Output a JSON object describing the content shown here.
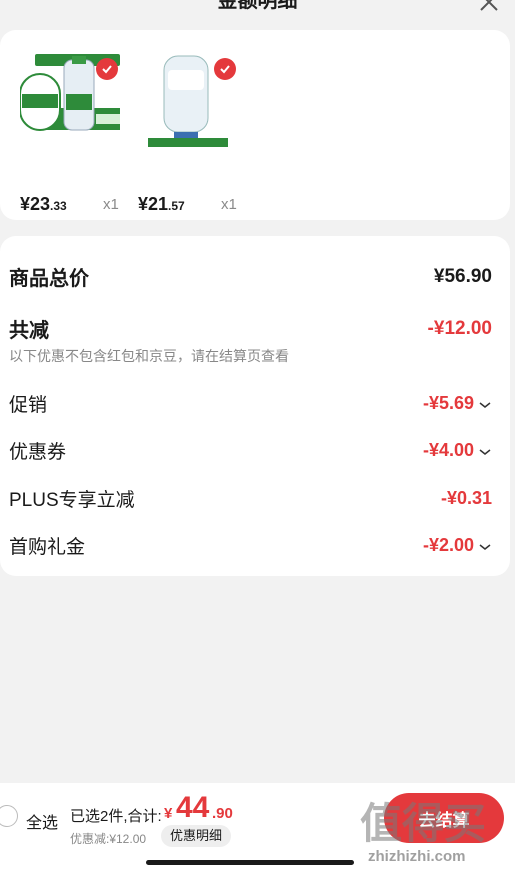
{
  "header": {
    "title": "金额明细"
  },
  "products": [
    {
      "price_int": "¥23",
      "price_dec": ".33",
      "qty": "x1",
      "image": "water-5l-bottle"
    },
    {
      "price_int": "¥21",
      "price_dec": ".57",
      "qty": "x1",
      "image": "water-bucket"
    }
  ],
  "summary": {
    "goods_total_label": "商品总价",
    "goods_total_value": "¥56.90",
    "total_reduce_label": "共减",
    "total_reduce_value": "-¥12.00",
    "note": "以下优惠不包含红包和京豆，请在结算页查看",
    "items": [
      {
        "label": "促销",
        "value": "-¥5.69",
        "has_chevron": true
      },
      {
        "label": "优惠券",
        "value": "-¥4.00",
        "has_chevron": true
      },
      {
        "label": "PLUS专享立减",
        "value": "-¥0.31",
        "has_chevron": false
      },
      {
        "label": "首购礼金",
        "value": "-¥2.00",
        "has_chevron": true
      }
    ]
  },
  "bottom_bar": {
    "select_all": "全选",
    "selected_text": "已选2件,合计:",
    "total_symbol": "¥",
    "total_int": "44",
    "total_dec": ".90",
    "discount_text": "优惠减:¥12.00",
    "detail_chip": "优惠明细",
    "checkout": "去结算"
  },
  "watermark": {
    "text": "值得买",
    "url": "zhizhizhi.com"
  },
  "colors": {
    "accent": "#e4393c",
    "background": "#f2f2f2"
  }
}
